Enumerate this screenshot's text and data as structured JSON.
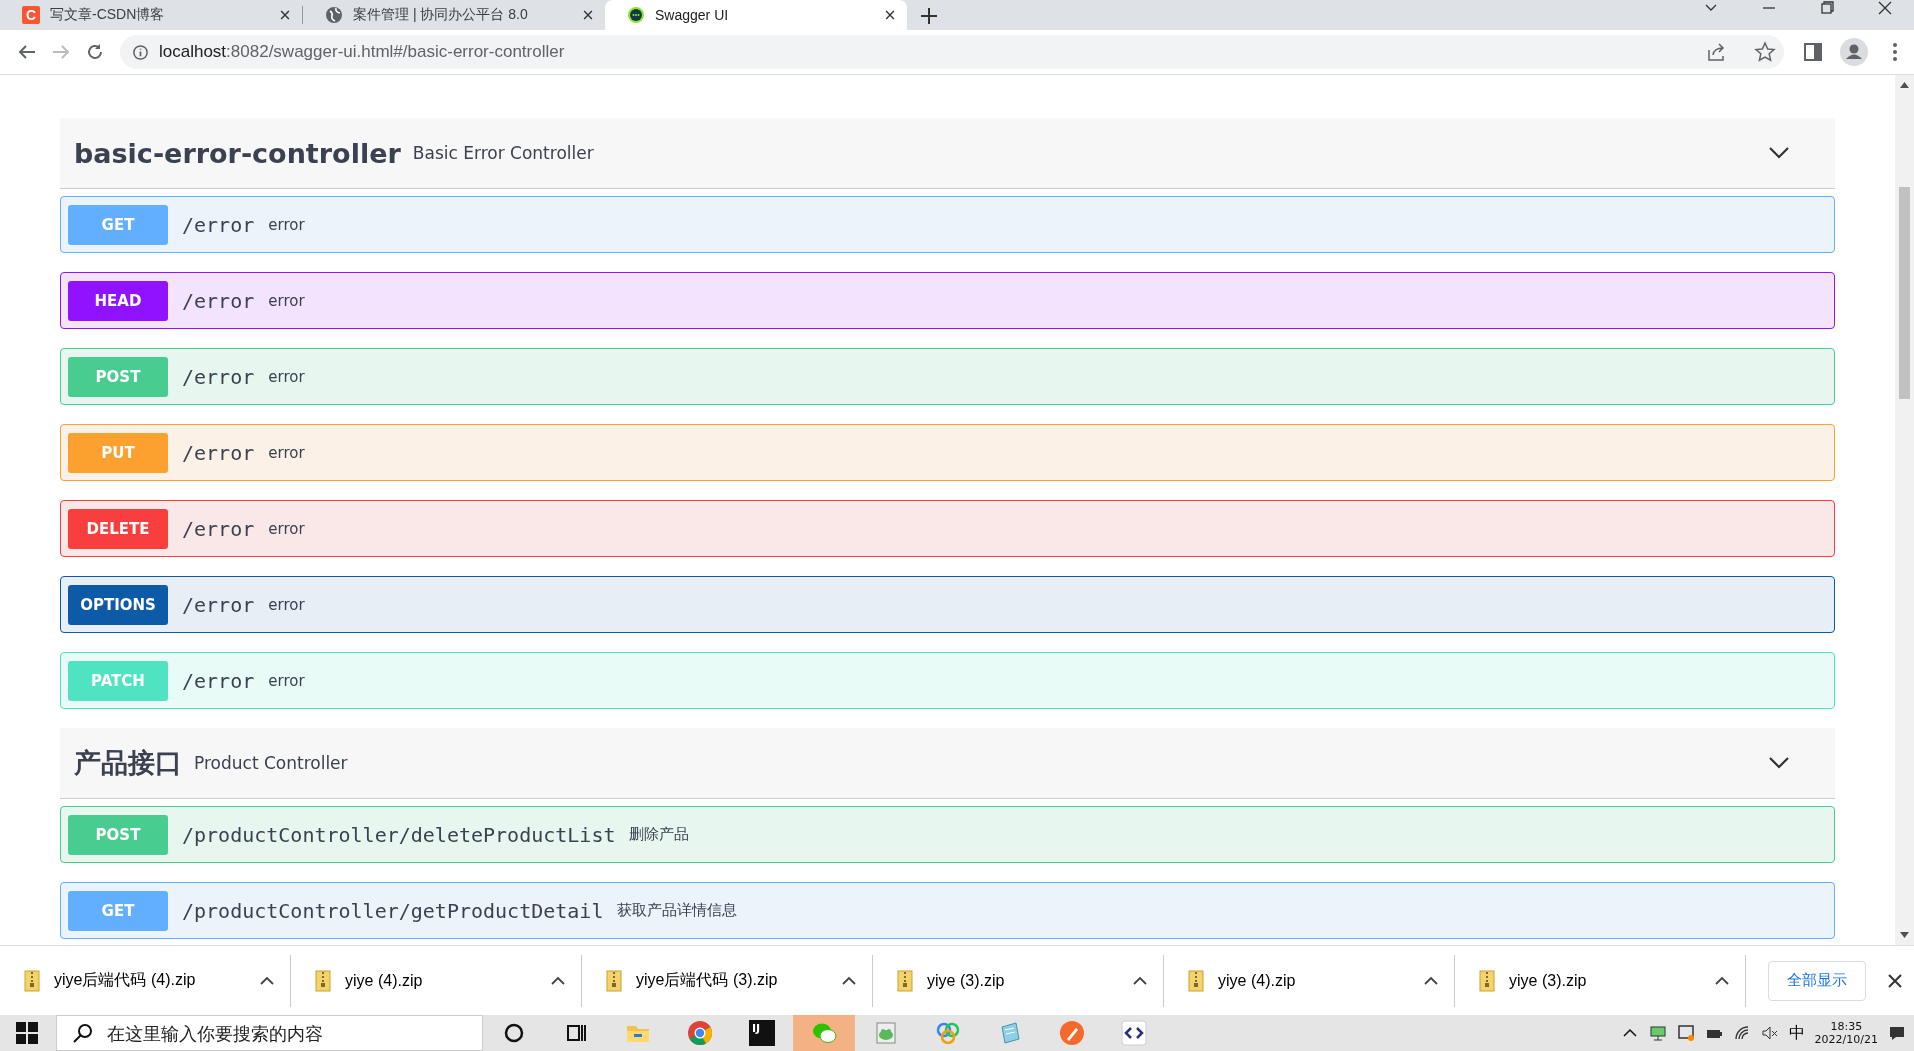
{
  "browser": {
    "tabs": [
      {
        "kind": "csdn",
        "icon_text": "C",
        "title": "写文章-CSDN博客",
        "selected": false
      },
      {
        "kind": "globe",
        "title": "案件管理 | 协同办公平台 8.0",
        "selected": false
      },
      {
        "kind": "swagger",
        "title": "Swagger UI",
        "selected": true
      }
    ],
    "url": {
      "host": "localhost",
      "rest": ":8082/swagger-ui.html#/basic-error-controller"
    }
  },
  "sections": [
    {
      "name": "basic-error-controller",
      "description": "Basic Error Controller",
      "expanded": true,
      "operations": [
        {
          "kind": "get",
          "method": "GET",
          "path": "/error",
          "summary": "error"
        },
        {
          "kind": "head",
          "method": "HEAD",
          "path": "/error",
          "summary": "error"
        },
        {
          "kind": "post",
          "method": "POST",
          "path": "/error",
          "summary": "error"
        },
        {
          "kind": "put",
          "method": "PUT",
          "path": "/error",
          "summary": "error"
        },
        {
          "kind": "delete",
          "method": "DELETE",
          "path": "/error",
          "summary": "error"
        },
        {
          "kind": "options",
          "method": "OPTIONS",
          "path": "/error",
          "summary": "error"
        },
        {
          "kind": "patch",
          "method": "PATCH",
          "path": "/error",
          "summary": "error"
        }
      ]
    },
    {
      "name": "产品接口",
      "description": "Product Controller",
      "expanded": true,
      "operations": [
        {
          "kind": "post",
          "method": "POST",
          "path": "/productController/deleteProductList",
          "summary": "删除产品"
        },
        {
          "kind": "get",
          "method": "GET",
          "path": "/productController/getProductDetail",
          "summary": "获取产品详情信息"
        }
      ]
    }
  ],
  "downloads": {
    "items": [
      {
        "name": "yiye后端代码 (4).zip"
      },
      {
        "name": "yiye (4).zip"
      },
      {
        "name": "yiye后端代码 (3).zip"
      },
      {
        "name": "yiye (3).zip"
      },
      {
        "name": "yiye (4).zip"
      },
      {
        "name": "yiye (3).zip"
      }
    ],
    "show_all": "全部显示"
  },
  "taskbar": {
    "search": {
      "placeholder": "在这里输入你要搜索的内容"
    },
    "apps": [
      {
        "kind": "cortana",
        "active": false
      },
      {
        "kind": "taskview",
        "active": false
      },
      {
        "kind": "folder",
        "active": false
      },
      {
        "kind": "chrome",
        "active": false
      },
      {
        "kind": "ide",
        "label": "IJ",
        "active": false
      },
      {
        "kind": "chat",
        "active": true
      },
      {
        "kind": "frog",
        "active": false
      },
      {
        "kind": "rings",
        "active": false
      },
      {
        "kind": "notepad",
        "active": false
      },
      {
        "kind": "pen",
        "active": false
      },
      {
        "kind": "code",
        "active": false
      }
    ],
    "ime": "中",
    "time": "18:35",
    "date": "2022/10/21"
  }
}
